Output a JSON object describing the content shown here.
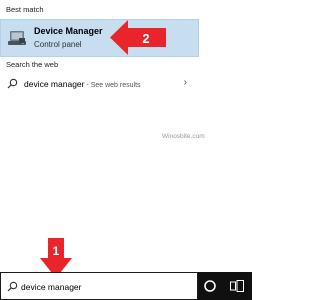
{
  "search_panel": {
    "best_match_header": "Best match",
    "best_match": {
      "name": "Device Manager",
      "type": "Control panel",
      "icon": "device-manager-icon"
    },
    "web_header": "Search the web",
    "web_result": {
      "query": "device manager",
      "suffix": " - See web results",
      "icon": "search-icon"
    },
    "watermark": "Winosbite.com"
  },
  "taskbar": {
    "search_value": "device manager",
    "search_icon": "search-icon",
    "cortana_icon": "cortana-circle-icon",
    "taskview_icon": "task-view-icon"
  },
  "callouts": {
    "step1": "1",
    "step2": "2",
    "color": "#e8252a"
  }
}
